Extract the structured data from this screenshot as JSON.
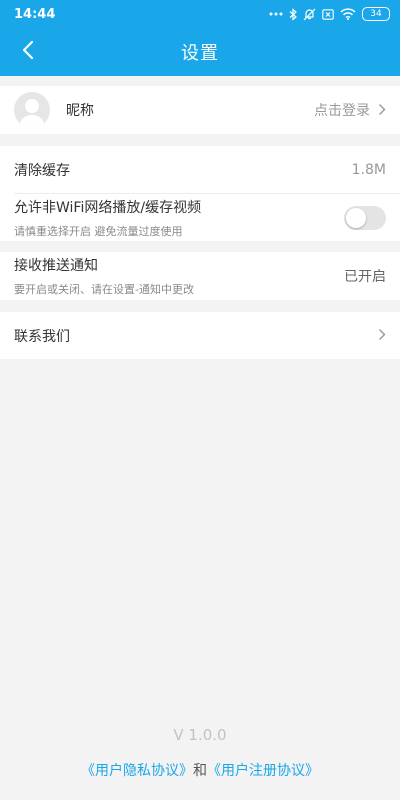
{
  "colors": {
    "accent": "#1aa7e9",
    "background": "#f3f3f3",
    "link": "#1aa7e9"
  },
  "status_bar": {
    "time": "14:44",
    "battery": "34",
    "icons": [
      "more-dots-icon",
      "bluetooth-icon",
      "mute-icon",
      "sim-x-icon",
      "wifi-icon",
      "battery-icon"
    ]
  },
  "nav": {
    "title": "设置",
    "back_icon": "back-arrow-icon"
  },
  "profile": {
    "nickname_label": "昵称",
    "login_text": "点击登录"
  },
  "cache": {
    "clear_label": "清除缓存",
    "cache_size": "1.8M",
    "non_wifi_label": "允许非WiFi网络播放/缓存视频",
    "non_wifi_sub": "请慎重选择开启 避免流量过度使用",
    "non_wifi_enabled": false
  },
  "push": {
    "label": "接收推送通知",
    "sub": "要开启或关闭、请在设置-通知中更改",
    "status": "已开启"
  },
  "contact": {
    "label": "联系我们"
  },
  "footer": {
    "version": "V 1.0.0",
    "privacy_link": "《用户隐私协议》",
    "and_text": "和",
    "register_link": "《用户注册协议》"
  }
}
